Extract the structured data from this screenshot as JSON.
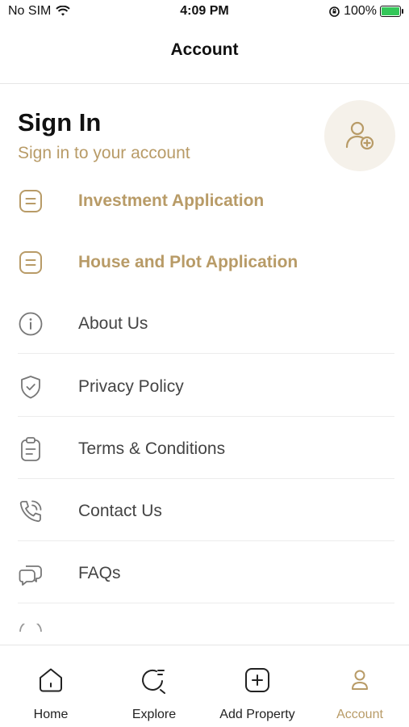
{
  "status_bar": {
    "carrier": "No SIM",
    "time": "4:09 PM",
    "battery": "100%"
  },
  "header": {
    "title": "Account"
  },
  "sign_in": {
    "title": "Sign In",
    "subtitle": "Sign in to your account"
  },
  "menu": [
    {
      "label": "Investment Application",
      "icon": "document-icon"
    },
    {
      "label": "House and Plot Application",
      "icon": "document-icon"
    },
    {
      "label": "About Us",
      "icon": "info-icon"
    },
    {
      "label": "Privacy Policy",
      "icon": "shield-check-icon"
    },
    {
      "label": "Terms & Conditions",
      "icon": "clipboard-icon"
    },
    {
      "label": "Contact Us",
      "icon": "phone-icon"
    },
    {
      "label": "FAQs",
      "icon": "chat-bubbles-icon"
    }
  ],
  "tabs": [
    {
      "label": "Home",
      "icon": "home-icon"
    },
    {
      "label": "Explore",
      "icon": "explore-icon"
    },
    {
      "label": "Add Property",
      "icon": "add-square-icon"
    },
    {
      "label": "Account",
      "icon": "user-icon",
      "active": true
    }
  ],
  "colors": {
    "accent": "#b89b67",
    "avatar_bg": "#f5f1ea",
    "battery": "#34c759"
  }
}
